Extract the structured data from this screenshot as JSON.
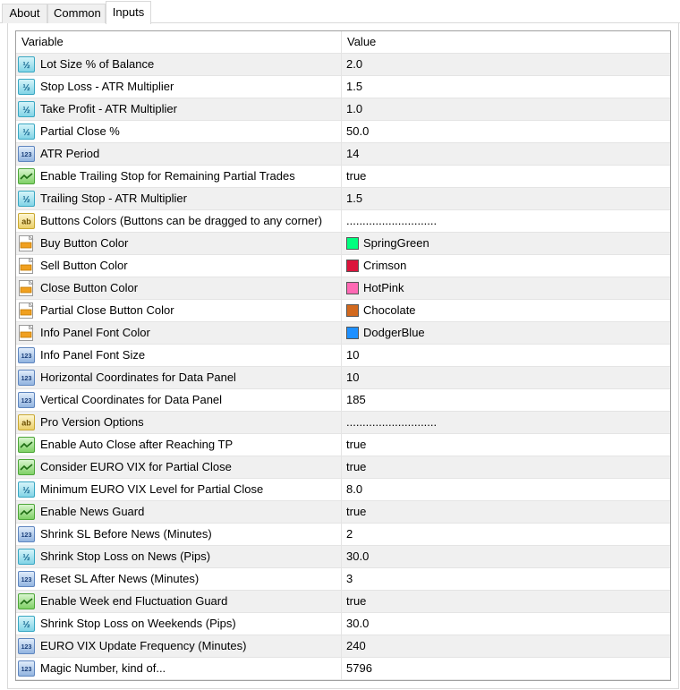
{
  "tabs": [
    {
      "label": "About"
    },
    {
      "label": "Common"
    },
    {
      "label": "Inputs"
    }
  ],
  "table": {
    "headers": {
      "variable": "Variable",
      "value": "Value"
    },
    "rows": [
      {
        "icon": "fraction-icon",
        "name": "Lot Size % of Balance",
        "value": "2.0"
      },
      {
        "icon": "fraction-icon",
        "name": "Stop Loss - ATR Multiplier",
        "value": "1.5"
      },
      {
        "icon": "fraction-icon",
        "name": "Take Profit - ATR Multiplier",
        "value": "1.0"
      },
      {
        "icon": "fraction-icon",
        "name": "Partial Close %",
        "value": "50.0"
      },
      {
        "icon": "integer-icon",
        "name": "ATR Period",
        "value": "14"
      },
      {
        "icon": "boolean-icon",
        "name": "Enable Trailing Stop for Remaining Partial Trades",
        "value": "true"
      },
      {
        "icon": "fraction-icon",
        "name": "Trailing Stop - ATR Multiplier",
        "value": "1.5"
      },
      {
        "icon": "string-icon",
        "name": "Buttons Colors (Buttons can be dragged to any corner)",
        "value": "............................"
      },
      {
        "icon": "color-icon",
        "name": "Buy Button Color",
        "value": "SpringGreen",
        "swatch": "#00ff7f"
      },
      {
        "icon": "color-icon",
        "name": "Sell Button Color",
        "value": "Crimson",
        "swatch": "#dc143c"
      },
      {
        "icon": "color-icon",
        "name": "Close Button Color",
        "value": "HotPink",
        "swatch": "#ff69b4"
      },
      {
        "icon": "color-icon",
        "name": "Partial Close Button Color",
        "value": "Chocolate",
        "swatch": "#d2691e"
      },
      {
        "icon": "color-icon",
        "name": "Info Panel Font Color",
        "value": "DodgerBlue",
        "swatch": "#1e90ff"
      },
      {
        "icon": "integer-icon",
        "name": "Info Panel Font Size",
        "value": "10"
      },
      {
        "icon": "integer-icon",
        "name": "Horizontal Coordinates for Data Panel",
        "value": "10"
      },
      {
        "icon": "integer-icon",
        "name": "Vertical Coordinates for Data Panel",
        "value": "185"
      },
      {
        "icon": "string-icon",
        "name": "Pro Version Options",
        "value": "............................"
      },
      {
        "icon": "boolean-icon",
        "name": "Enable Auto Close after Reaching TP",
        "value": "true"
      },
      {
        "icon": "boolean-icon",
        "name": "Consider EURO VIX for Partial Close",
        "value": "true"
      },
      {
        "icon": "fraction-icon",
        "name": "Minimum EURO VIX Level for Partial Close",
        "value": "8.0"
      },
      {
        "icon": "boolean-icon",
        "name": "Enable News Guard",
        "value": "true"
      },
      {
        "icon": "integer-icon",
        "name": "Shrink SL Before News (Minutes)",
        "value": "2"
      },
      {
        "icon": "fraction-icon",
        "name": "Shrink Stop Loss on News (Pips)",
        "value": "30.0"
      },
      {
        "icon": "integer-icon",
        "name": "Reset SL After News (Minutes)",
        "value": "3"
      },
      {
        "icon": "boolean-icon",
        "name": "Enable Week end Fluctuation Guard",
        "value": "true"
      },
      {
        "icon": "fraction-icon",
        "name": "Shrink Stop Loss on Weekends (Pips)",
        "value": "30.0"
      },
      {
        "icon": "integer-icon",
        "name": "EURO VIX Update Frequency (Minutes)",
        "value": "240"
      },
      {
        "icon": "integer-icon",
        "name": "Magic Number, kind of...",
        "value": "5796"
      }
    ]
  }
}
